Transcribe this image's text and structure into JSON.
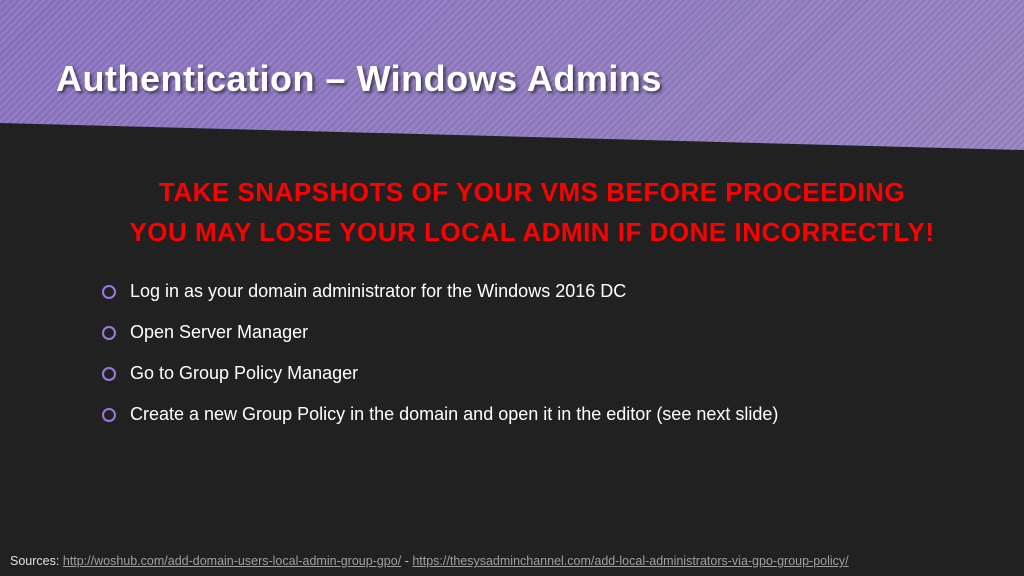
{
  "header": {
    "title": "Authentication – Windows Admins"
  },
  "warning": {
    "line1": "TAKE SNAPSHOTS OF YOUR VMS BEFORE PROCEEDING",
    "line2": "YOU MAY LOSE YOUR LOCAL ADMIN IF DONE INCORRECTLY!"
  },
  "steps": [
    "Log in as your domain administrator for the Windows 2016 DC",
    "Open Server Manager",
    "Go to Group Policy Manager",
    "Create a new Group Policy in the domain and open it in the editor (see next slide)"
  ],
  "footer": {
    "label": "Sources:",
    "link1": "http://woshub.com/add-domain-users-local-admin-group-gpo/",
    "sep": " - ",
    "link2": "https://thesysadminchannel.com/add-local-administrators-via-gpo-group-policy/"
  }
}
